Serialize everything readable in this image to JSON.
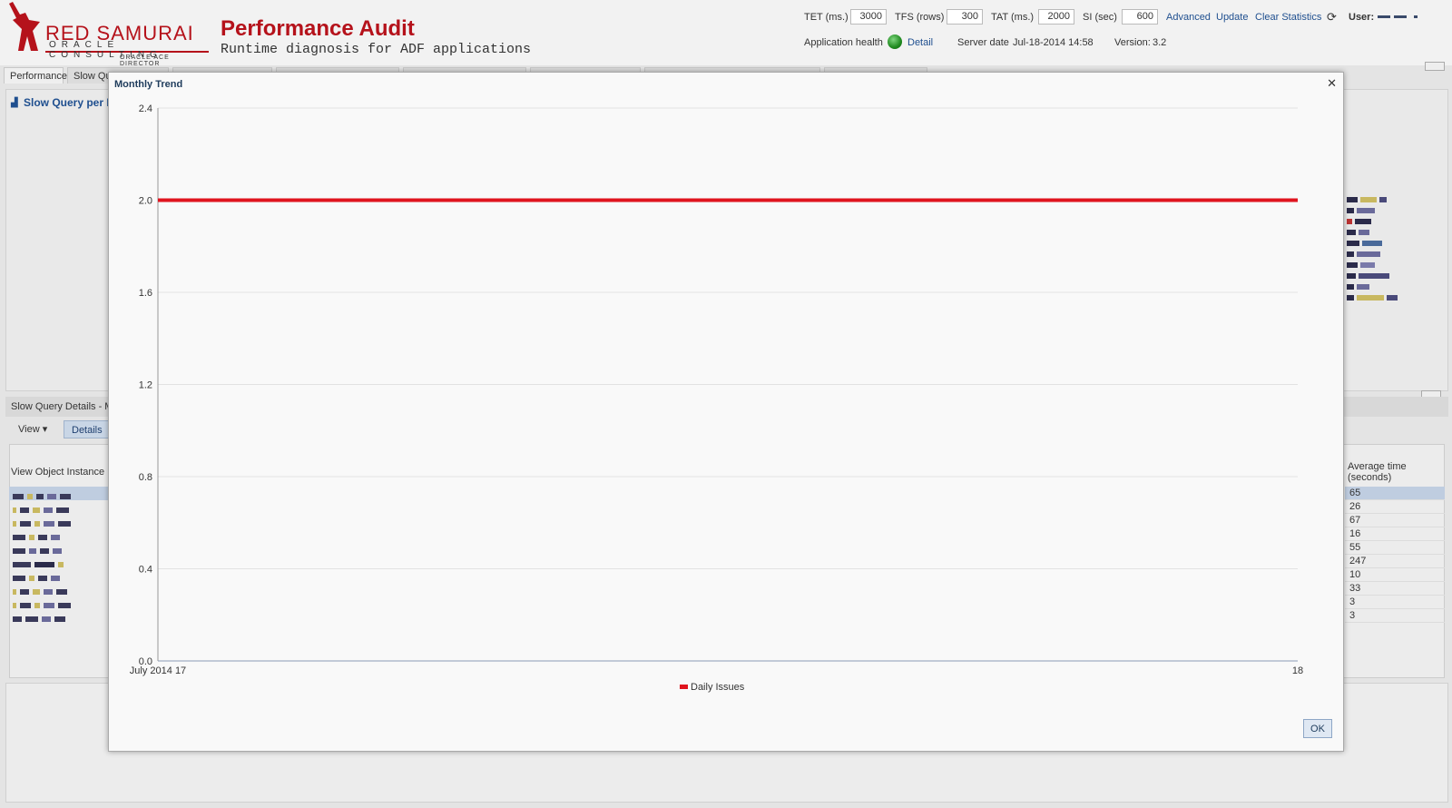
{
  "header": {
    "logo_text": "RED SAMURAI",
    "logo_subtext": "ORACLE CONSULTING",
    "logo_tag": "ORACLE ACE DIRECTOR",
    "title": "Performance Audit",
    "subtitle": "Runtime diagnosis for ADF applications",
    "params": {
      "tet_label": "TET (ms.)",
      "tet_value": "3000",
      "tfs_label": "TFS (rows)",
      "tfs_value": "300",
      "tat_label": "TAT (ms.)",
      "tat_value": "2000",
      "si_label": "SI (sec)",
      "si_value": "600"
    },
    "links": {
      "advanced": "Advanced",
      "update": "Update",
      "clear": "Clear Statistics"
    },
    "user_label": "User:",
    "health_label": "Application health",
    "health_detail": "Detail",
    "server_date_label": "Server date",
    "server_date": "Jul-18-2014 14:58",
    "version_label": "Version:",
    "version": "3.2"
  },
  "tabs": {
    "performance": "Performance",
    "slow_query": "Slow Qu"
  },
  "background": {
    "top_panel_title": "Slow Query per M",
    "bottom_panel_title": "Slow Query Details - Mo",
    "view_label": "View",
    "details_label": "Details",
    "col_left": "View Object Instance N",
    "col_right": "Average time (seconds)",
    "avg_values": [
      "65",
      "26",
      "67",
      "16",
      "55",
      "247",
      "10",
      "33",
      "3",
      "3"
    ]
  },
  "modal": {
    "title": "Monthly Trend",
    "ok_label": "OK"
  },
  "colors": {
    "brand_red": "#b5121b",
    "series_red": "#e0141e",
    "link_blue": "#1f4f8f"
  },
  "chart_data": {
    "type": "line",
    "title": "",
    "x": [
      "July 2014 17",
      "18"
    ],
    "series": [
      {
        "name": "Daily Issues",
        "values": [
          2,
          2
        ]
      }
    ],
    "ylim": [
      0,
      2.4
    ],
    "yticks": [
      "0.0",
      "0.4",
      "0.8",
      "1.2",
      "1.6",
      "2.0",
      "2.4"
    ],
    "grid": true,
    "legend_position": "bottom-center"
  }
}
